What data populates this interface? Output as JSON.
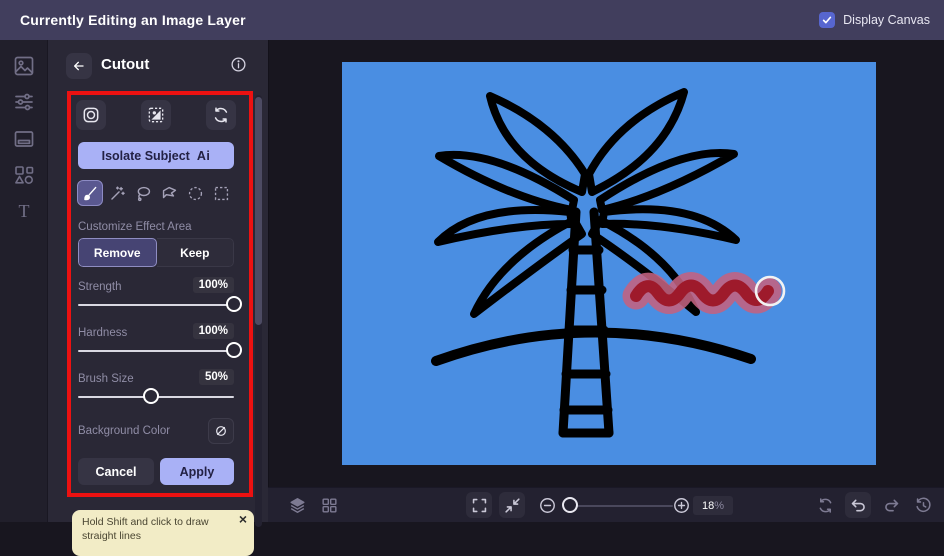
{
  "topbar": {
    "title": "Currently Editing an Image Layer",
    "display_canvas_label": "Display Canvas",
    "display_canvas_checked": true
  },
  "sidebar": {
    "icons": [
      "image-layer",
      "adjustments",
      "frames",
      "shapes",
      "text"
    ]
  },
  "panel": {
    "title": "Cutout",
    "header_icons": [
      "back-arrow",
      "info"
    ],
    "mode_icons": [
      "lens",
      "subject-selection",
      "refresh"
    ],
    "isolate": {
      "label": "Isolate Subject",
      "badge": "Ai"
    },
    "tools": [
      "brush",
      "magic-wand",
      "lasso",
      "polygon-lasso",
      "ellipse-select",
      "rect-select"
    ],
    "selected_tool": "brush",
    "customize_label": "Customize Effect Area",
    "area": {
      "remove": "Remove",
      "keep": "Keep",
      "selected": "Remove"
    },
    "sliders": [
      {
        "label": "Strength",
        "value": "100%",
        "percent": 100
      },
      {
        "label": "Hardness",
        "value": "100%",
        "percent": 100
      },
      {
        "label": "Brush Size",
        "value": "50%",
        "percent": 47
      }
    ],
    "background_color_label": "Background Color",
    "background_color_icon": "none-slashed-circle",
    "cancel_label": "Cancel",
    "apply_label": "Apply",
    "tip": {
      "text": "Hold Shift and click to draw straight lines",
      "close": "×"
    }
  },
  "canvas": {
    "content": "palm-tree-line-art",
    "background_color": "#4a8ee2",
    "line_color": "#000000",
    "brush_stroke": {
      "core_color": "#9e1a2b",
      "halo_color": "#c4627f",
      "shape": "wavy-squiggle"
    },
    "brush_cursor": "circle-outline"
  },
  "bottombar": {
    "left_icons": [
      "layers",
      "layout-grid"
    ],
    "center_icons": [
      "fullscreen",
      "fit-to-screen",
      "zoom-out",
      "zoom-in"
    ],
    "zoom_value": "18",
    "zoom_unit": "%",
    "zoom_slider_percent": 6,
    "right_icons": [
      "refresh",
      "undo",
      "redo",
      "history"
    ]
  },
  "colors": {
    "topbar": "#413e5d",
    "sidebar": "#211f2b",
    "panel": "#2a2836",
    "workspace": "#18161f",
    "bottombar": "#232130",
    "accent": "#a9b1f6",
    "accent_text": "#232144",
    "annotation_red": "#ec1111",
    "checkbox_blue": "#5766cf",
    "canvas_blue": "#4a8ee2"
  }
}
